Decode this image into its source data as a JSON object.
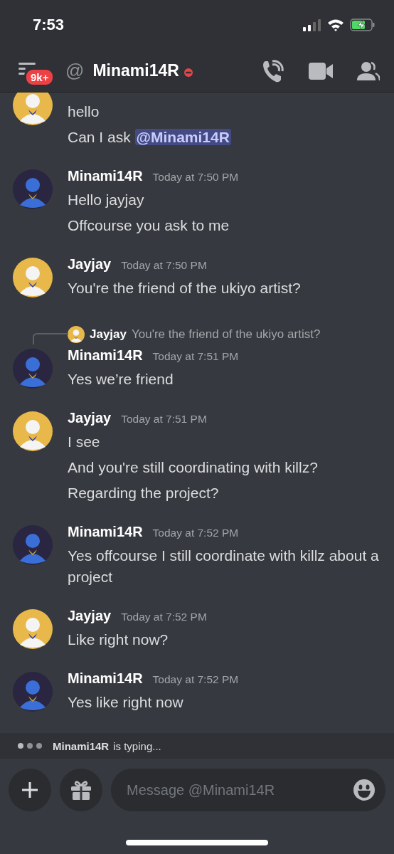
{
  "status_bar": {
    "time": "7:53"
  },
  "header": {
    "badge": "9k+",
    "at_sign": "@",
    "channel": "Minami14R",
    "status": {
      "kind": "dnd"
    }
  },
  "messages": [
    {
      "avatar": {
        "kind": "light"
      },
      "lines": [
        {
          "text": "hello"
        },
        {
          "text": "Can I ask ",
          "mention": "@Minami14R"
        }
      ]
    },
    {
      "avatar": {
        "kind": "dark"
      },
      "author": "Minami14R",
      "time": "Today at 7:50 PM",
      "lines": [
        {
          "text": "Hello jayjay"
        },
        {
          "text": "Offcourse you ask to me"
        }
      ]
    },
    {
      "avatar": {
        "kind": "light"
      },
      "author": "Jayjay",
      "time": "Today at 7:50 PM",
      "lines": [
        {
          "text": "You're the friend of the ukiyo artist?"
        }
      ]
    },
    {
      "avatar": {
        "kind": "dark"
      },
      "author": "Minami14R",
      "time": "Today at 7:51 PM",
      "reply": {
        "avatar": {
          "kind": "light"
        },
        "author": "Jayjay",
        "text": "You're the friend of the ukiyo artist?"
      },
      "lines": [
        {
          "text": "Yes we’re friend"
        }
      ]
    },
    {
      "avatar": {
        "kind": "light"
      },
      "author": "Jayjay",
      "time": "Today at 7:51 PM",
      "lines": [
        {
          "text": "I see"
        },
        {
          "text": "And you're still coordinating with killz?"
        },
        {
          "text": "Regarding the project?"
        }
      ]
    },
    {
      "avatar": {
        "kind": "dark"
      },
      "author": "Minami14R",
      "time": "Today at 7:52 PM",
      "lines": [
        {
          "text": "Yes offcourse I still coordinate with killz about a project"
        }
      ]
    },
    {
      "avatar": {
        "kind": "light"
      },
      "author": "Jayjay",
      "time": "Today at 7:52 PM",
      "lines": [
        {
          "text": "Like right now?"
        }
      ]
    },
    {
      "avatar": {
        "kind": "dark"
      },
      "author": "Minami14R",
      "time": "Today at 7:52 PM",
      "lines": [
        {
          "text": "Yes like right now"
        }
      ]
    }
  ],
  "typing": {
    "author": "Minami14R",
    "text": "is typing..."
  },
  "composer": {
    "placeholder": "Message @Minami14R"
  }
}
